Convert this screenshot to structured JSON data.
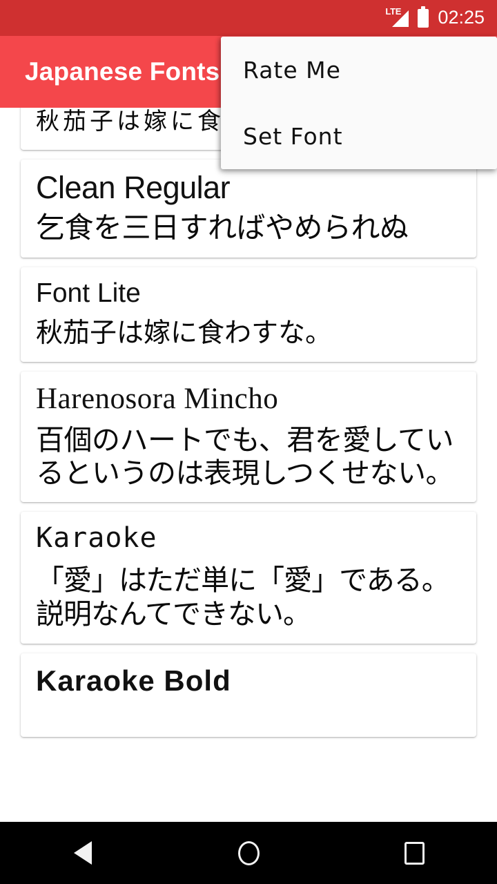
{
  "status_bar": {
    "network_label": "LTE",
    "time": "02:25",
    "background_color": "#cf3030",
    "icons": [
      "signal-triangle-icon",
      "battery-full-icon"
    ]
  },
  "app_bar": {
    "title": "Japanese Fonts",
    "background_color": "#f4474b",
    "text_color": "#ffffff"
  },
  "overflow_menu": {
    "visible": true,
    "background_color": "#fafafa",
    "items": [
      {
        "label": "Rate Me"
      },
      {
        "label": "Set Font"
      }
    ]
  },
  "font_list": {
    "cards": [
      {
        "name": "",
        "sample": "秋茄子は嫁に食わ",
        "style_class": "f-hand",
        "partially_hidden": true
      },
      {
        "name": "Clean Regular",
        "sample": "乞食を三日すればやめられぬ",
        "style_class": "f-clean"
      },
      {
        "name": "Font Lite",
        "sample": "秋茄子は嫁に食わすな。",
        "style_class": "f-lite"
      },
      {
        "name": "Harenosora Mincho",
        "sample": "百個のハートでも、君を愛しているというのは表現しつくせない。",
        "style_class": "f-mincho"
      },
      {
        "name": "Karaoke",
        "sample": "「愛」はただ単に「愛」である。説明なんてできない。",
        "style_class": "f-karaoke"
      },
      {
        "name": "Karaoke Bold",
        "sample": "",
        "style_class": "f-karaoke-bold"
      }
    ]
  },
  "nav_bar": {
    "background_color": "#000000",
    "buttons": [
      {
        "name": "back",
        "icon": "triangle-left-icon"
      },
      {
        "name": "home",
        "icon": "circle-icon"
      },
      {
        "name": "recents",
        "icon": "square-icon"
      }
    ]
  }
}
